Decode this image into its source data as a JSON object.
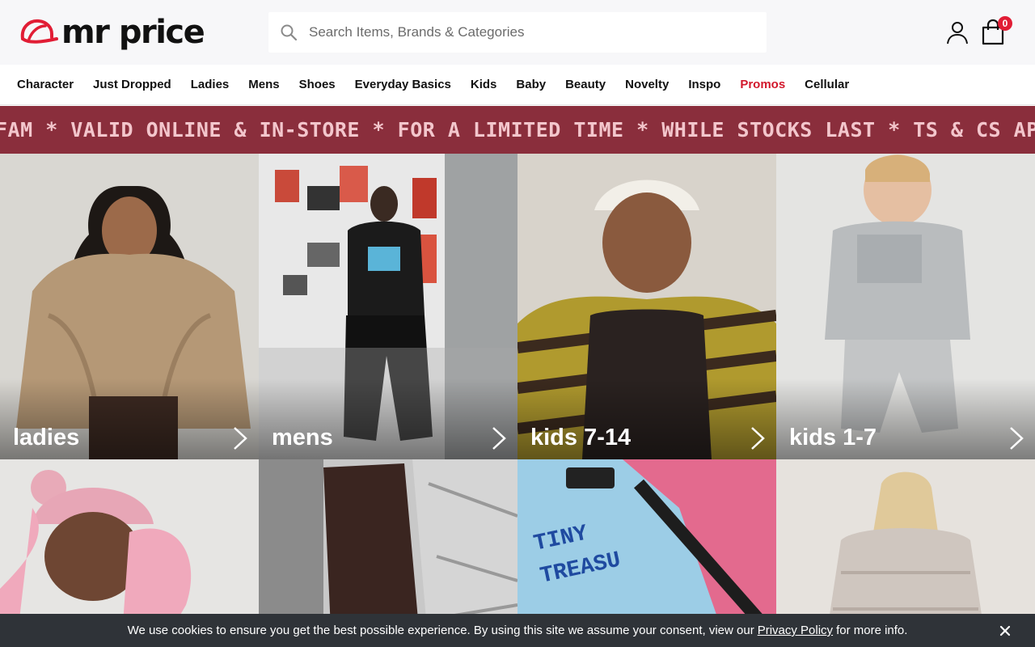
{
  "brand": {
    "name": "mr price",
    "accent": "#e11d35"
  },
  "search": {
    "placeholder": "Search Items, Brands & Categories",
    "value": ""
  },
  "header": {
    "cart_count": "0"
  },
  "nav": {
    "items": [
      "Character",
      "Just Dropped",
      "Ladies",
      "Mens",
      "Shoes",
      "Everyday Basics",
      "Kids",
      "Baby",
      "Beauty",
      "Novelty",
      "Inspo",
      "Promos",
      "Cellular"
    ],
    "highlight": "Promos",
    "highlight_color": "#d2182c"
  },
  "banner": {
    "text": "FAM * VALID ONLINE & IN-STORE * FOR A LIMITED TIME * WHILE STOCKS LAST * TS & CS APPLY",
    "bg": "#8a2e3c"
  },
  "tiles": [
    {
      "label": "ladies"
    },
    {
      "label": "mens"
    },
    {
      "label": "kids 7-14"
    },
    {
      "label": "kids 1-7"
    }
  ],
  "tiles_row2_text": [
    "TINY",
    "TREASU"
  ],
  "cookie": {
    "text_before": "We use cookies to ensure you get the best possible experience. By using this site we assume your consent, view our",
    "link": "Privacy Policy",
    "text_after": "for more info."
  }
}
